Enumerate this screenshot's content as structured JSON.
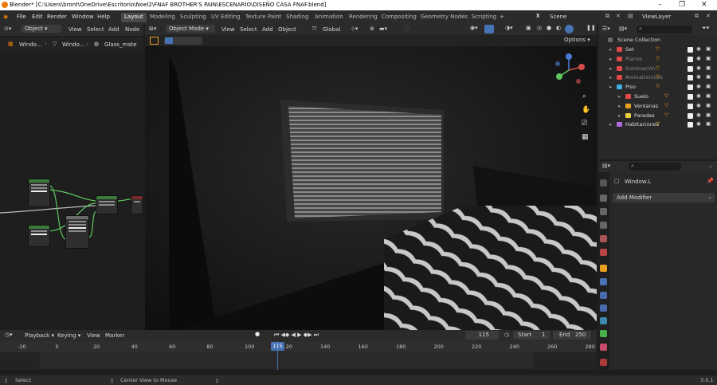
{
  "window": {
    "title": "Blender* [C:\\Users\\bront\\OneDrive\\Escritorio\\Noel2\\FNAF BROTHER'S PAIN\\ESCENARIO\\DISEÑO CASA FNAF.blend]"
  },
  "menu": [
    "File",
    "Edit",
    "Render",
    "Window",
    "Help"
  ],
  "workspaces": [
    "Layout",
    "Modeling",
    "Sculpting",
    "UV Editing",
    "Texture Paint",
    "Shading",
    "Animation",
    "Rendering",
    "Compositing",
    "Geometry Nodes",
    "Scripting"
  ],
  "active_workspace": "Layout",
  "scene": "Scene",
  "view_layer": "ViewLayer",
  "node_editor": {
    "mode": "Object",
    "menus": [
      "View",
      "Select",
      "Add",
      "Node"
    ],
    "breadcrumb": [
      "Windo...",
      "Windo...",
      "Glass_mate"
    ]
  },
  "viewport": {
    "mode": "Object Mode",
    "menus": [
      "View",
      "Select",
      "Add",
      "Object"
    ],
    "transform": "Global",
    "options": "Options"
  },
  "outliner": {
    "title": "Scene Collection",
    "items": [
      {
        "label": "Set",
        "color": "#e04848",
        "dim": false
      },
      {
        "label": "Planos",
        "color": "#e04848",
        "dim": true
      },
      {
        "label": "Iluminación",
        "color": "#e04848",
        "dim": true
      },
      {
        "label": "Animatronicos",
        "color": "#e04848",
        "dim": true
      },
      {
        "label": "Piso",
        "color": "#3fb0e0",
        "dim": false
      },
      {
        "label": "Suelo",
        "color": "#e04848",
        "dim": false
      },
      {
        "label": "Ventanas",
        "color": "#e8a020",
        "dim": false
      },
      {
        "label": "Paredes",
        "color": "#e8d040",
        "dim": false
      },
      {
        "label": "Habitaciones",
        "color": "#b06be0",
        "dim": false
      }
    ]
  },
  "properties": {
    "object": "Window.L",
    "add_modifier": "Add Modifier"
  },
  "timeline": {
    "menus": [
      "Playback",
      "Keying",
      "View",
      "Marker"
    ],
    "current_frame": "115",
    "start_label": "Start",
    "start": "1",
    "end_label": "End",
    "end": "250",
    "ticks": [
      "-20",
      "0",
      "20",
      "40",
      "60",
      "80",
      "100",
      "120",
      "140",
      "160",
      "180",
      "200",
      "220",
      "240",
      "260",
      "280"
    ]
  },
  "status": {
    "select": "Select",
    "center": "Center View to Mouse",
    "version": "3.0.1"
  }
}
